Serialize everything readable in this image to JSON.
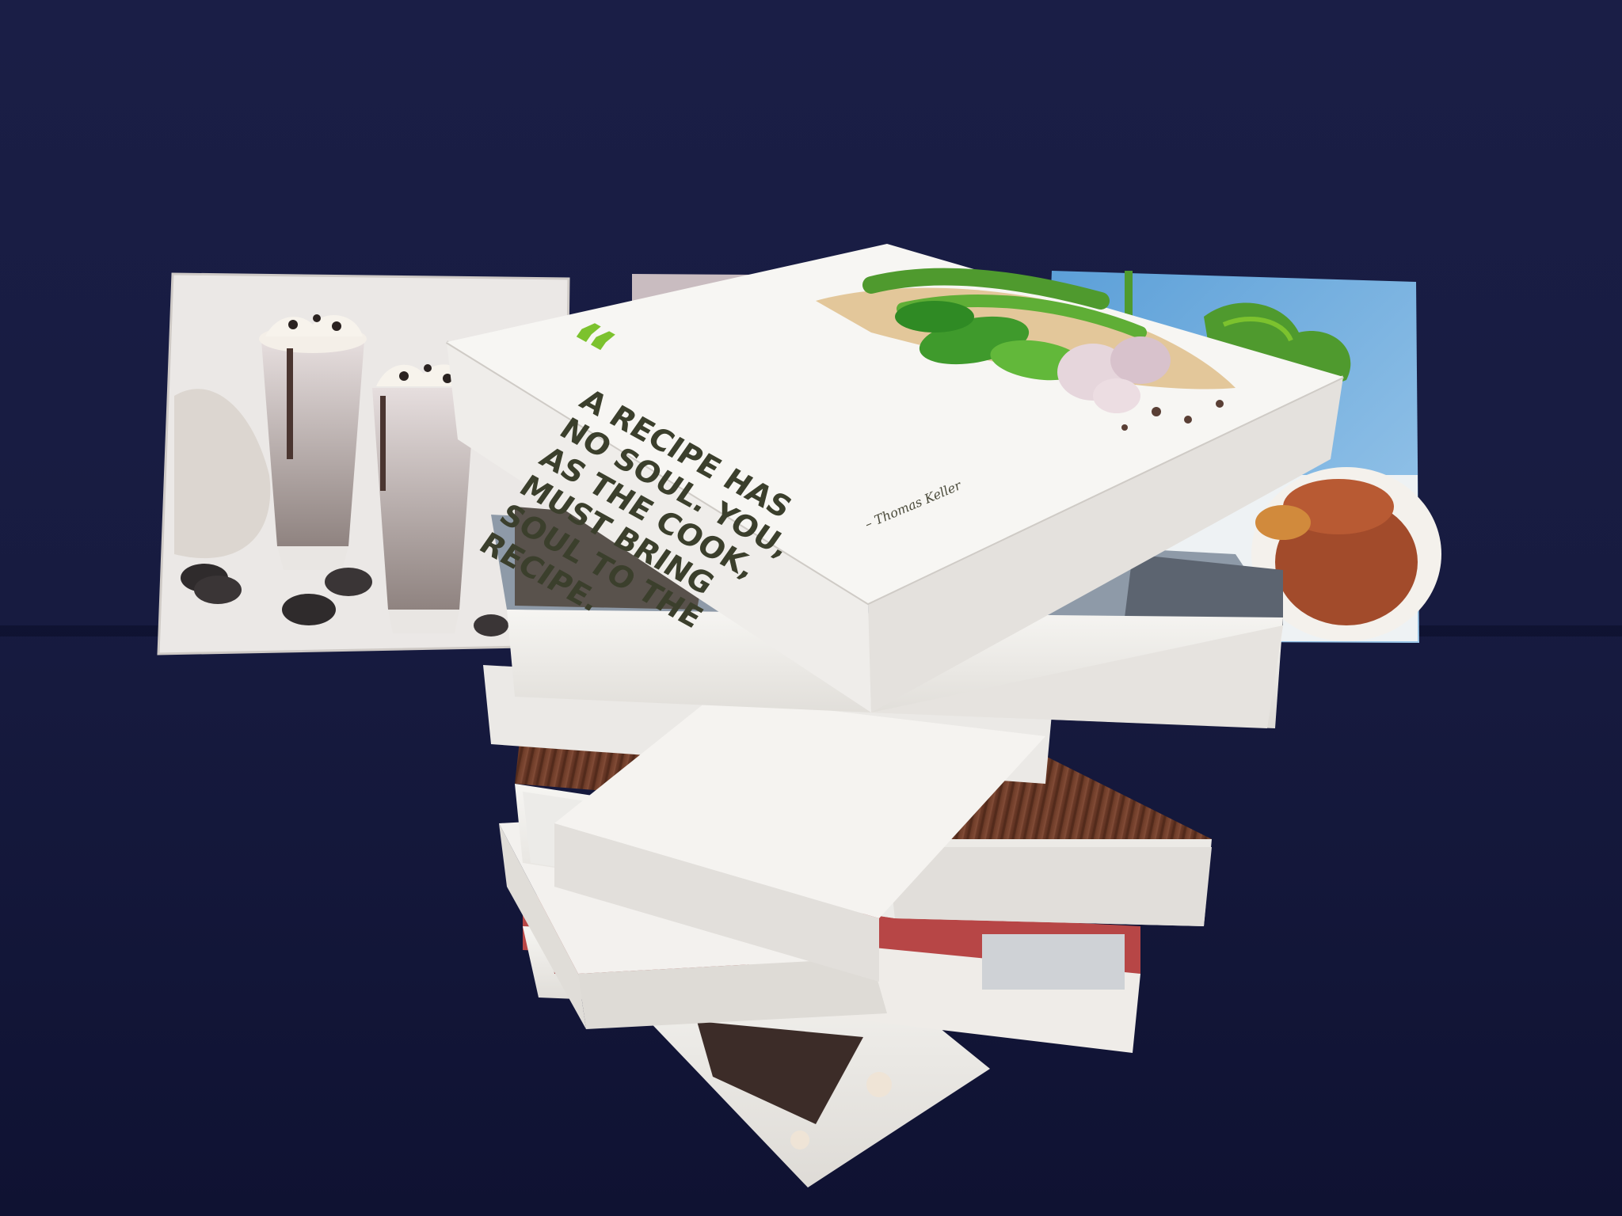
{
  "quote": {
    "mark": "“",
    "lines": [
      "A RECIPE HAS",
      "NO SOUL. YOU,",
      "AS THE COOK,",
      "MUST BRING",
      "SOUL TO THE",
      "RECIPE."
    ],
    "author": "– Thomas Keller"
  },
  "colors": {
    "backdrop": "#161a3e",
    "quote_accent": "#7cc22e",
    "quote_text": "#3b3f2c",
    "panel_white": "#f1efec",
    "panel_edge": "#dcd9d5",
    "wood": "#6b3a26"
  }
}
